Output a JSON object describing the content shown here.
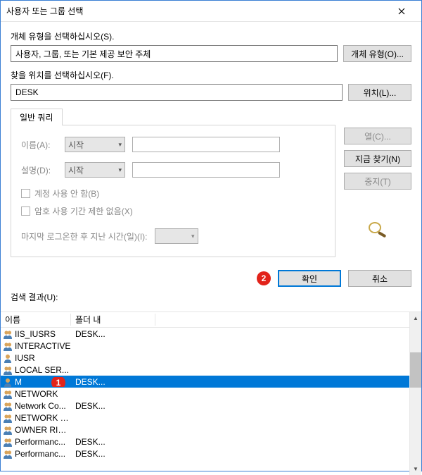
{
  "window": {
    "title": "사용자 또는 그룹 선택"
  },
  "labels": {
    "object_type_label": "개체 유형을 선택하십시오(S).",
    "object_type_value": "사용자, 그룹, 또는 기본 제공 보안 주체",
    "object_type_btn": "개체 유형(O)...",
    "location_label": "찾을 위치를 선택하십시오(F).",
    "location_value": "DESK",
    "location_btn": "위치(L)...",
    "tab_general": "일반 쿼리",
    "name_label": "이름(A):",
    "desc_label": "설명(D):",
    "combo_start": "시작",
    "chk_disabled": "계정 사용 안 함(B)",
    "chk_pwd": "암호 사용 기간 제한 없음(X)",
    "time_label": "마지막 로그온한 후 지난 시간(일)(I):",
    "btn_columns": "열(C)...",
    "btn_findnow": "지금 찾기(N)",
    "btn_stop": "중지(T)",
    "btn_ok": "확인",
    "btn_cancel": "취소",
    "result_label": "검색 결과(U):",
    "col_name": "이름",
    "col_folder": "폴더 내"
  },
  "annotations": {
    "badge1": "1",
    "badge2": "2"
  },
  "results": [
    {
      "icon": "group",
      "name": "IIS_IUSRS",
      "folder": "DESK..."
    },
    {
      "icon": "group",
      "name": "INTERACTIVE",
      "folder": ""
    },
    {
      "icon": "user",
      "name": "IUSR",
      "folder": ""
    },
    {
      "icon": "group",
      "name": "LOCAL SER...",
      "folder": ""
    },
    {
      "icon": "user",
      "name": "M",
      "folder": "DESK...",
      "selected": true
    },
    {
      "icon": "group",
      "name": "NETWORK",
      "folder": ""
    },
    {
      "icon": "group",
      "name": "Network Co...",
      "folder": "DESK..."
    },
    {
      "icon": "group",
      "name": "NETWORK S...",
      "folder": ""
    },
    {
      "icon": "group",
      "name": "OWNER RIG...",
      "folder": ""
    },
    {
      "icon": "group",
      "name": "Performanc...",
      "folder": "DESK..."
    },
    {
      "icon": "group",
      "name": "Performanc...",
      "folder": "DESK..."
    }
  ]
}
